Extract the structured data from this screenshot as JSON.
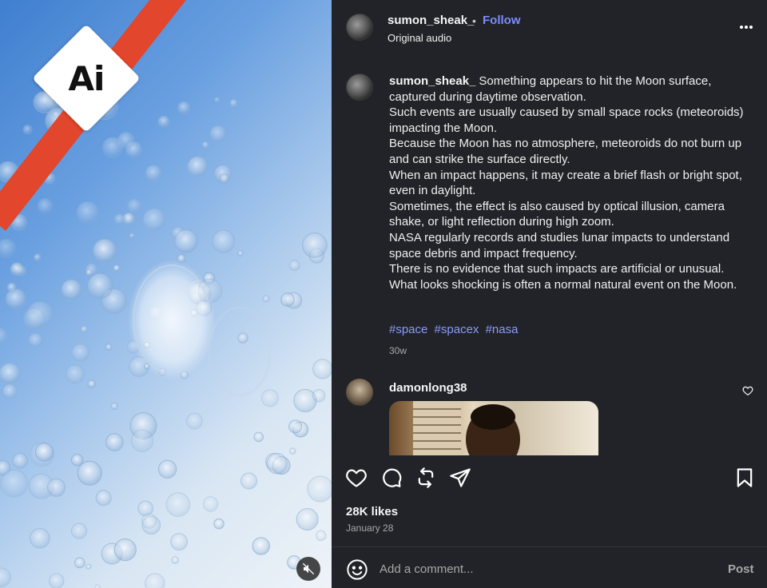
{
  "post": {
    "username": "sumon_sheak_",
    "separator": "•",
    "follow_label": "Follow",
    "audio_label": "Original audio",
    "more_label": "•••",
    "caption": "Something appears to hit the Moon surface, captured during daytime observation.\nSuch events are usually caused by small space rocks (meteoroids) impacting the Moon.\nBecause the Moon has no atmosphere, meteoroids do not burn up and can strike the surface directly.\nWhen an impact happens, it may create a brief flash or bright spot, even in daylight.\nSometimes, the effect is also caused by optical illusion, camera shake, or light reflection during high zoom.\nNASA regularly records and studies lunar impacts to understand space debris and impact frequency.\nThere is no evidence that such impacts are artificial or unusual.\nWhat looks shocking is often a normal natural event on the Moon.",
    "hashtags": [
      "#space",
      "#spacex",
      "#nasa"
    ],
    "age": "30w",
    "likes": "28K likes",
    "date": "January 28"
  },
  "media": {
    "badge_text": "Ai",
    "badge_band_color": "#e2462c"
  },
  "comments": [
    {
      "username": "damonlong38",
      "attachment": "gif"
    }
  ],
  "comment_bar": {
    "placeholder": "Add a comment...",
    "post_label": "Post"
  },
  "colors": {
    "panel_bg": "#212328",
    "link": "#7b8cff",
    "hashtag": "#8c9bff",
    "muted_text": "#a8a8a8"
  }
}
